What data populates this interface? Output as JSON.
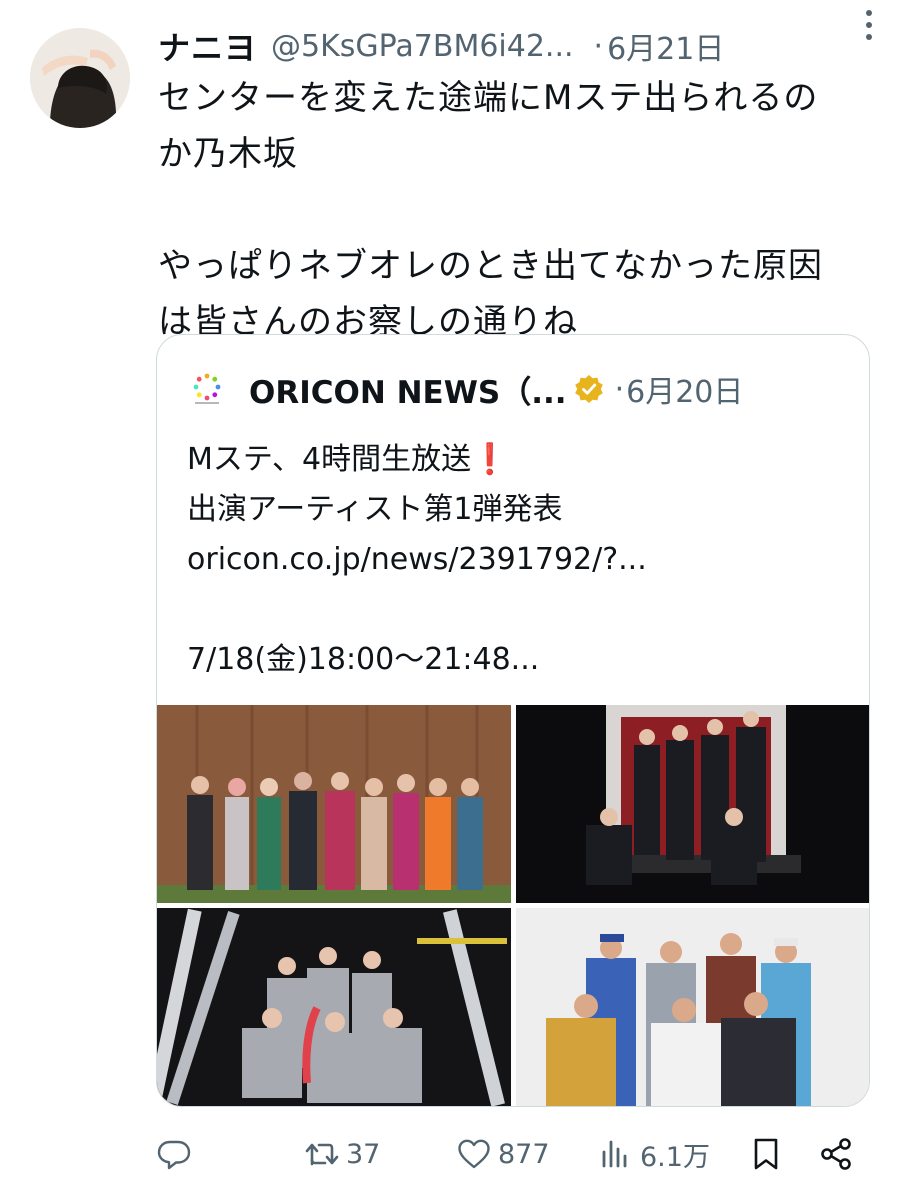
{
  "author": {
    "display_name": "ナニヨ",
    "handle": "@5KsGPa7BM6i42...",
    "separator": "·",
    "date": "6月21日"
  },
  "body": {
    "lines": [
      "センターを変えた途端にMステ出られるの",
      "か乃木坂",
      "",
      "やっぱりネブオレのとき出てなかった原因",
      "は皆さんのお察しの通りね"
    ]
  },
  "quote": {
    "name": "ORICON NEWS（...",
    "separator": "·",
    "date": "6月20日",
    "verified": true,
    "lines": {
      "line1": "Mステ、4時間生放送",
      "line1_emoji": "❗",
      "line2": "出演アーティスト第1弾発表",
      "line3": "oricon.co.jp/news/2391792/?...",
      "line5": "7/18(金)18:00～21:48..."
    }
  },
  "actions": {
    "replies": "",
    "retweets": "37",
    "likes": "877",
    "views": "6.1万"
  },
  "icons": {
    "more": "more-vertical-icon",
    "verified": "verified-badge-icon",
    "reply": "reply-icon",
    "retweet": "retweet-icon",
    "like": "heart-icon",
    "views": "views-chart-icon",
    "bookmark": "bookmark-icon",
    "share": "share-icon"
  },
  "colors": {
    "secondary_text": "#536471",
    "border": "#cfd9de",
    "verified_gold": "#e8b41e"
  }
}
